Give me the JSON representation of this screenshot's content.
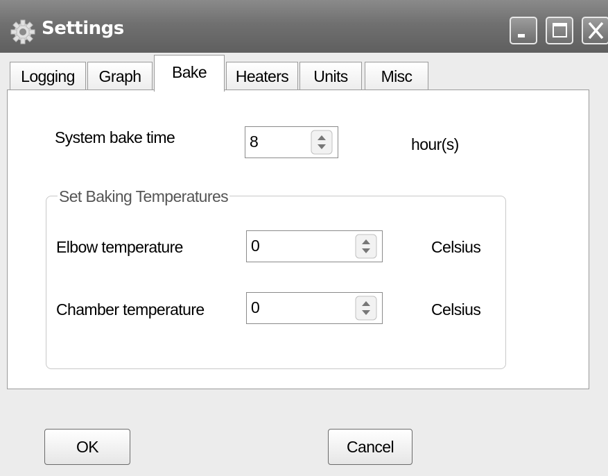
{
  "window": {
    "title": "Settings"
  },
  "tabs": [
    {
      "label": "Logging"
    },
    {
      "label": "Graph"
    },
    {
      "label": "Bake",
      "active": true
    },
    {
      "label": "Heaters"
    },
    {
      "label": "Units"
    },
    {
      "label": "Misc"
    }
  ],
  "bake": {
    "system_bake_time_label": "System bake time",
    "system_bake_time_value": "8",
    "system_bake_time_unit": "hour(s)",
    "group_title": "Set Baking Temperatures",
    "elbow_label": "Elbow temperature",
    "elbow_value": "0",
    "elbow_unit": "Celsius",
    "chamber_label": "Chamber temperature",
    "chamber_value": "0",
    "chamber_unit": "Celsius"
  },
  "buttons": {
    "ok": "OK",
    "cancel": "Cancel"
  },
  "icons": {
    "title": "gear-icon",
    "minimize": "minimize-icon",
    "maximize": "maximize-icon",
    "close": "close-icon",
    "spinner": "spinner-arrows-icon"
  },
  "colors": {
    "titlebar": "#707070",
    "panel": "#ffffff",
    "window_bg": "#ececec"
  }
}
